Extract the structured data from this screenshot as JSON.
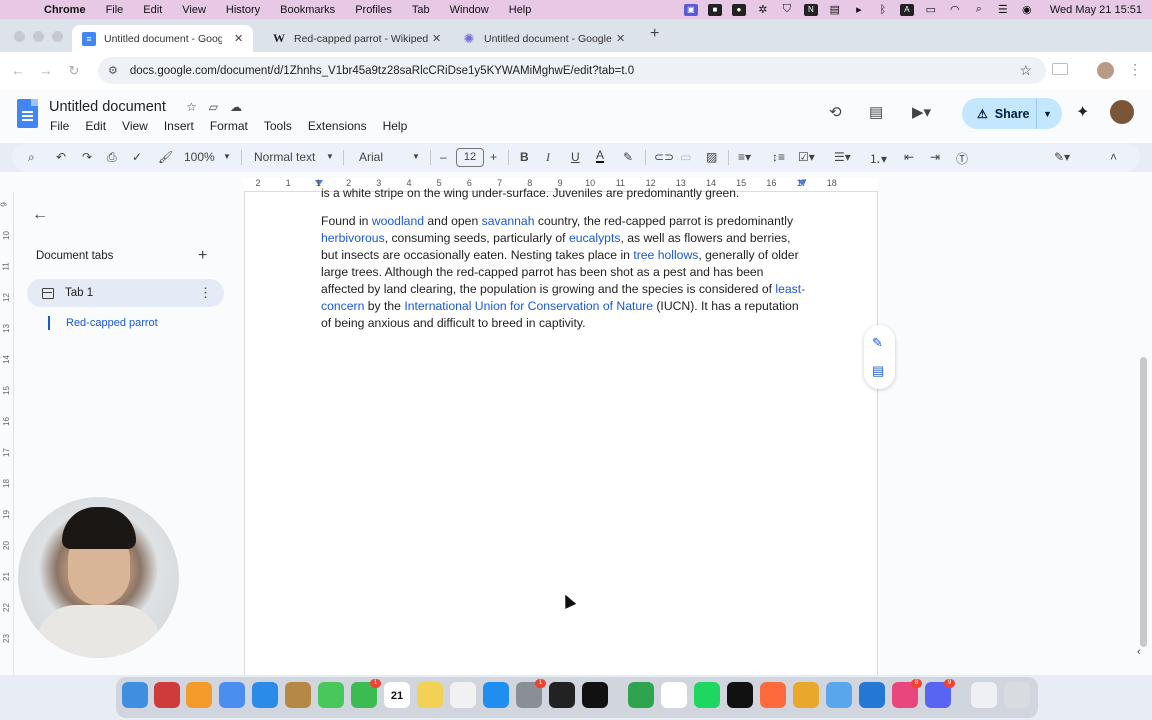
{
  "menubar": {
    "app": "Chrome",
    "items": [
      "File",
      "Edit",
      "View",
      "History",
      "Bookmarks",
      "Profiles",
      "Tab",
      "Window",
      "Help"
    ],
    "clock": "Wed May 21  15:51"
  },
  "tabs": [
    {
      "title": "Untitled document - Google Docs",
      "icon": "docs-icon"
    },
    {
      "title": "Red-capped parrot - Wikipedia",
      "icon": "wikipedia-icon"
    },
    {
      "title": "Untitled document - Google Docs",
      "icon": "gemini-icon"
    }
  ],
  "address": {
    "url": "docs.google.com/document/d/1Zhnhs_V1br45a9tz28saRlcCRiDse1y5KYWAMiMghwE/edit?tab=t.0"
  },
  "docs": {
    "title": "Untitled document",
    "menu": [
      "File",
      "Edit",
      "View",
      "Insert",
      "Format",
      "Tools",
      "Extensions",
      "Help"
    ],
    "share_label": "Share"
  },
  "format_toolbar": {
    "zoom": "100%",
    "style": "Normal text",
    "font": "Arial",
    "font_size": "12"
  },
  "ruler": {
    "numbers": [
      "2",
      "1",
      "1",
      "2",
      "3",
      "4",
      "5",
      "6",
      "7",
      "8",
      "9",
      "10",
      "11",
      "12",
      "13",
      "14",
      "15",
      "16",
      "17",
      "18"
    ]
  },
  "vruler": {
    "numbers": [
      "9",
      "10",
      "11",
      "12",
      "13",
      "14",
      "15",
      "16",
      "17",
      "18",
      "19",
      "20",
      "21",
      "22",
      "23"
    ]
  },
  "sidebar": {
    "heading": "Document tabs",
    "tab_label": "Tab 1",
    "outline_item": "Red-capped parrot"
  },
  "document": {
    "clipped_line": "is a white stripe on the wing under-surface. Juveniles are predominantly green.",
    "para": {
      "s1": "Found in ",
      "l1": "woodland",
      "s2": " and open ",
      "l2": "savannah",
      "s3": " country, the red-capped parrot is predominantly ",
      "l3": "herbivorous",
      "s4": ", consuming seeds, particularly of ",
      "l4": "eucalypts",
      "s5": ", as well as flowers and berries, but insects are occasionally eaten. Nesting takes place in ",
      "l5": "tree hollows",
      "s6": ", generally of older large trees. Although the red-capped parrot has been shot as a pest and has been affected by land clearing, the population is growing and the species is considered of ",
      "l6": "least-concern",
      "s7": " by the ",
      "l7": "International Union for Conservation of Nature",
      "s8": " (IUCN). It has a reputation of being anxious and difficult to breed in captivity."
    }
  },
  "dock": {
    "calendar_day": "21"
  }
}
